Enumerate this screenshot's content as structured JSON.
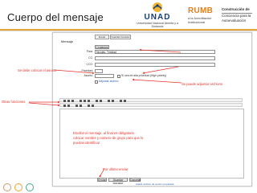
{
  "slide": {
    "title": "Cuerpo del mensaje"
  },
  "logos": {
    "unad_name": "UNAD",
    "unad_sub": "Universidad Nacional Abierta y a Distancia",
    "rumbo_word": "RUMB",
    "rumbo_sub": "a la Acreditación Institucional",
    "comp_l1": "Construcción de",
    "comp_l2": "Conciencia para la Autoevaluación"
  },
  "form": {
    "top_buttons": [
      "Enviar",
      "Guardar borrador"
    ],
    "heading": "Mensaje",
    "fields": [
      {
        "label": "",
        "value": "Contactos"
      },
      {
        "label": "Para:",
        "value": "Nicolás, Trinidad"
      },
      {
        "label": "CC:",
        "value": ""
      },
      {
        "label": "CCO:",
        "value": ""
      },
      {
        "label": "Prioridad:",
        "value": ""
      },
      {
        "label": "Asunto:",
        "value": ""
      }
    ],
    "attach_label": "Adjuntar archivo",
    "priority_option": "Sí sea de alta prioridad (High priority)",
    "bottom_buttons": [
      "Enviar",
      "Guardar borrador",
      "Cancelar"
    ],
    "bottom_link": "Añadir archivo de sesión preparada"
  },
  "annotations": {
    "subject": "Se debe colocar el asunto",
    "attach": "Se puede adjuntar archivos",
    "functions": "Otras funciones",
    "body_note": [
      "Escribir el mensaje, al final  es obligatorio",
      "colocar nombre y número de grupo para que lo",
      "puedan identificar"
    ],
    "send": "Por ultimo enviar"
  }
}
